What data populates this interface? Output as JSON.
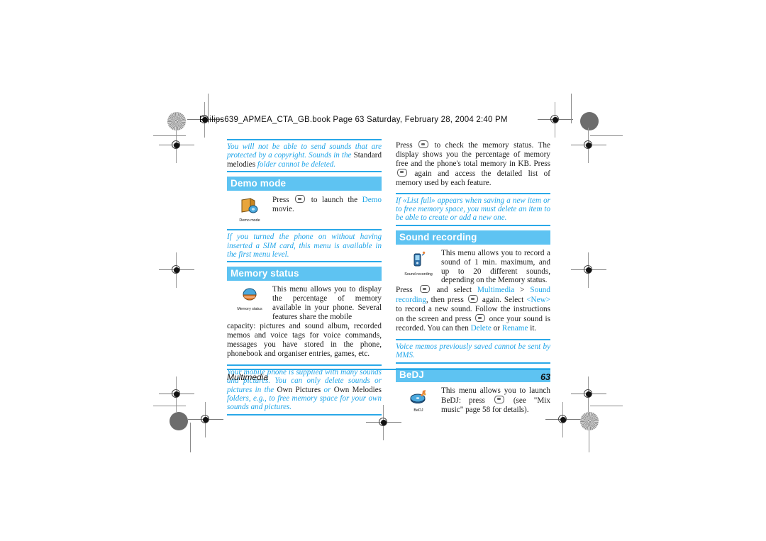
{
  "document": {
    "file_header": "Philips639_APMEA_CTA_GB.book  Page 63  Saturday, February 28, 2004  2:40 PM",
    "footer_chapter": "Multimedia",
    "footer_page": "63"
  },
  "left_column": {
    "note_sounds": {
      "text_1": "You will not be able to send sounds that are protected by a copyright. Sounds in the ",
      "emph_1": "Standard melodies",
      "text_2": " folder cannot be deleted."
    },
    "demo_mode": {
      "title": "Demo mode",
      "icon_caption": "Demo mode",
      "icon_name": "demo-mode-icon",
      "text_1": "Press ",
      "key": "ok-key",
      "text_2": " to launch the ",
      "link": "Demo",
      "text_3": " movie."
    },
    "note_sim": {
      "text": "If you turned the phone on without having inserted a SIM card, this menu is available in the first menu level."
    },
    "memory_status": {
      "title": "Memory status",
      "icon_caption": "Memory status",
      "icon_name": "memory-status-icon",
      "text_indent": "This menu allows you to display the percentage of memory available in your phone. Several features share the mobile",
      "text_rest": "capacity: pictures and sound album, recorded memos and voice tags for voice commands, messages you have stored in the phone, phonebook and organiser entries, games, etc."
    },
    "note_supplied": {
      "text_1": "Your mobile phone is supplied with many sounds and pictures. You can only delete sounds or pictures in the ",
      "emph_1": "Own Pictures",
      "text_2": " or ",
      "emph_2": "Own Melodies",
      "text_3": " folders, e.g., to free memory space for your own sounds and pictures."
    }
  },
  "right_column": {
    "memory_check": {
      "text_1": "Press ",
      "key_1": "ok-key",
      "text_2": " to check the memory status. The display shows you the percentage of memory free and the phone's total memory in KB. Press ",
      "key_2": "ok-key",
      "text_3": " again and access the detailed list of memory used by each feature."
    },
    "note_list_full": {
      "text": "If «List full» appears when saving a new item or to free memory space, you must delete an item to be able to create or add a new one."
    },
    "sound_recording": {
      "title": "Sound recording",
      "icon_caption": "Sound recording",
      "icon_name": "sound-recording-icon",
      "text_indent": "This menu allows you to record a sound of 1 min. maximum, and up to 20 different sounds, depending on the Memory status.",
      "p2_t1": "Press ",
      "p2_key1": "ok-key",
      "p2_t2": " and select ",
      "p2_l1": "Multimedia",
      "p2_t3": " > ",
      "p2_l2": "Sound recording",
      "p2_t4": ", then press ",
      "p2_key2": "ok-key",
      "p2_t5": " again. Select ",
      "p2_l3": "<New>",
      "p2_t6": " to record a new sound. Follow the instructions on the screen and press ",
      "p2_key3": "ok-key",
      "p2_t7": " once your sound is recorded. You can then ",
      "p2_l4": "Delete",
      "p2_t8": " or ",
      "p2_l5": "Rename",
      "p2_t9": " it."
    },
    "note_voice_memos": {
      "text": "Voice memos previously saved cannot be sent by MMS."
    },
    "bedj": {
      "title": "BeDJ",
      "icon_caption": "BeDJ",
      "icon_name": "bedj-icon",
      "text_1": "This menu allows you to launch BeDJ: press ",
      "key": "ok-key",
      "text_2": " (see \"Mix music\" page 58 for details)."
    }
  },
  "colors": {
    "accent": "#5ec3f2",
    "link": "#19a3e6",
    "rule": "#2aa8e8"
  }
}
